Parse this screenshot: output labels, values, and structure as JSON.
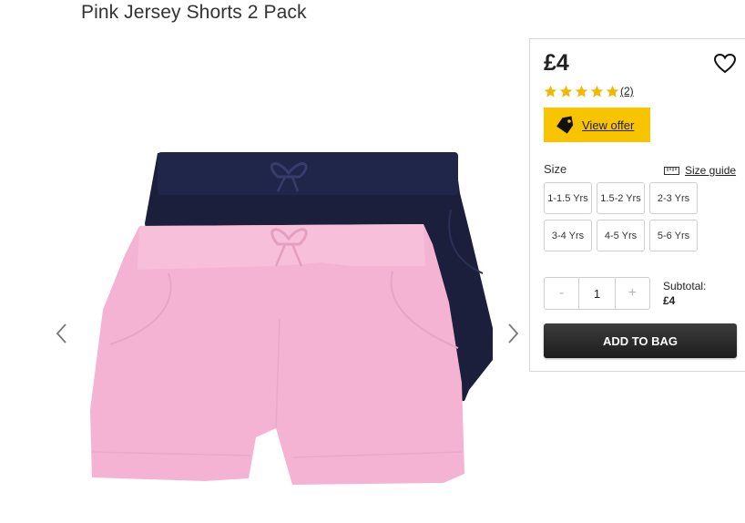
{
  "product": {
    "title": "Pink Jersey Shorts 2 Pack",
    "price": "£4",
    "rating": 5,
    "review_count": "(2)",
    "offer_label": "View offer",
    "size_label": "Size",
    "size_guide_label": "Size guide",
    "sizes": [
      "1-1.5 Yrs",
      "1.5-2 Yrs",
      "2-3 Yrs",
      "3-4 Yrs",
      "4-5 Yrs",
      "5-6 Yrs"
    ],
    "quantity": {
      "minus": "-",
      "value": "1",
      "plus": "+"
    },
    "subtotal_label": "Subtotal:",
    "subtotal_value": "£4",
    "add_to_bag_label": "ADD TO BAG"
  },
  "colors": {
    "offer_yellow": "#f8c400",
    "star_yellow": "#f2b800",
    "button_dark": "#222222",
    "shorts_pink": "#f4b3d2",
    "shorts_navy": "#1b1f3b"
  }
}
